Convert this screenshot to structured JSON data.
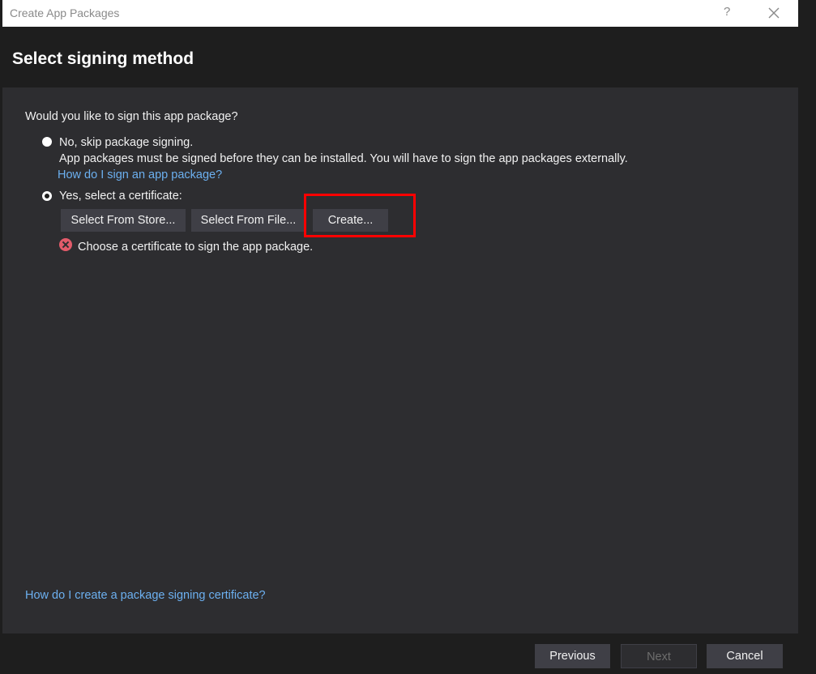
{
  "window": {
    "title": "Create App Packages",
    "help_label": "?"
  },
  "header": {
    "title": "Select signing method"
  },
  "content": {
    "question": "Would you like to sign this app package?",
    "option_no": {
      "label": "No, skip package signing.",
      "description": "App packages must be signed before they can be installed. You will have to sign the app packages externally.",
      "link": "How do I sign an app package?",
      "selected": false
    },
    "option_yes": {
      "label": "Yes, select a certificate:",
      "selected": true
    },
    "buttons": {
      "select_from_store": "Select From Store...",
      "select_from_file": "Select From File...",
      "create": "Create..."
    },
    "error": "Choose a certificate to sign the app package.",
    "help_link": "How do I create a package signing certificate?"
  },
  "footer": {
    "previous": "Previous",
    "next": "Next",
    "cancel": "Cancel"
  },
  "colors": {
    "highlight": "#ff0000",
    "link": "#6cb0f0",
    "error": "#e35b6a"
  },
  "icons": {
    "close": "close-icon",
    "error": "error-icon"
  }
}
